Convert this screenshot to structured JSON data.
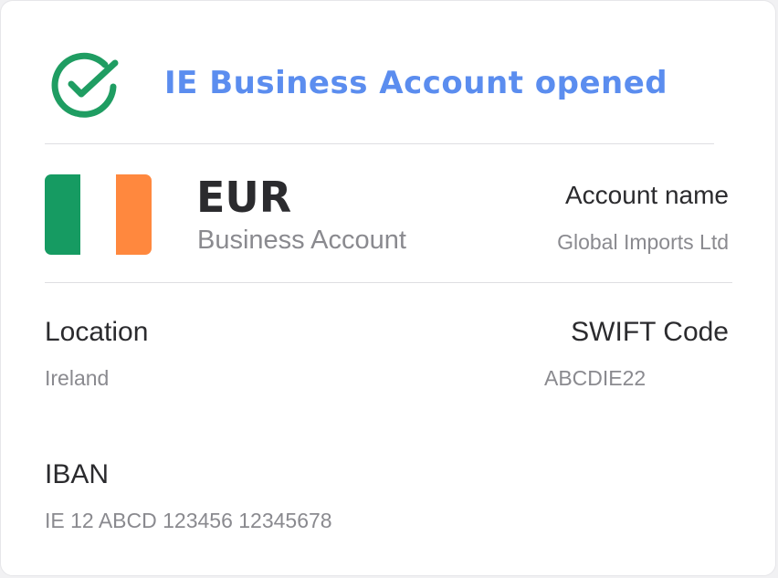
{
  "header": {
    "title": "IE Business Account opened",
    "icon": "check-circle-icon"
  },
  "colors": {
    "accent_blue": "#5b8def",
    "success_green": "#1f9d62",
    "flag_green": "#169b62",
    "flag_white": "#ffffff",
    "flag_orange": "#ff883e"
  },
  "account": {
    "flag_icon": "ireland-flag-icon",
    "currency": "EUR",
    "type": "Business Account",
    "name_label": "Account name",
    "name_value": "Global Imports Ltd"
  },
  "details": {
    "location_label": "Location",
    "location_value": "Ireland",
    "swift_label": "SWIFT Code",
    "swift_value": "ABCDIE22",
    "iban_label": "IBAN",
    "iban_value": "IE 12 ABCD 123456 12345678"
  }
}
